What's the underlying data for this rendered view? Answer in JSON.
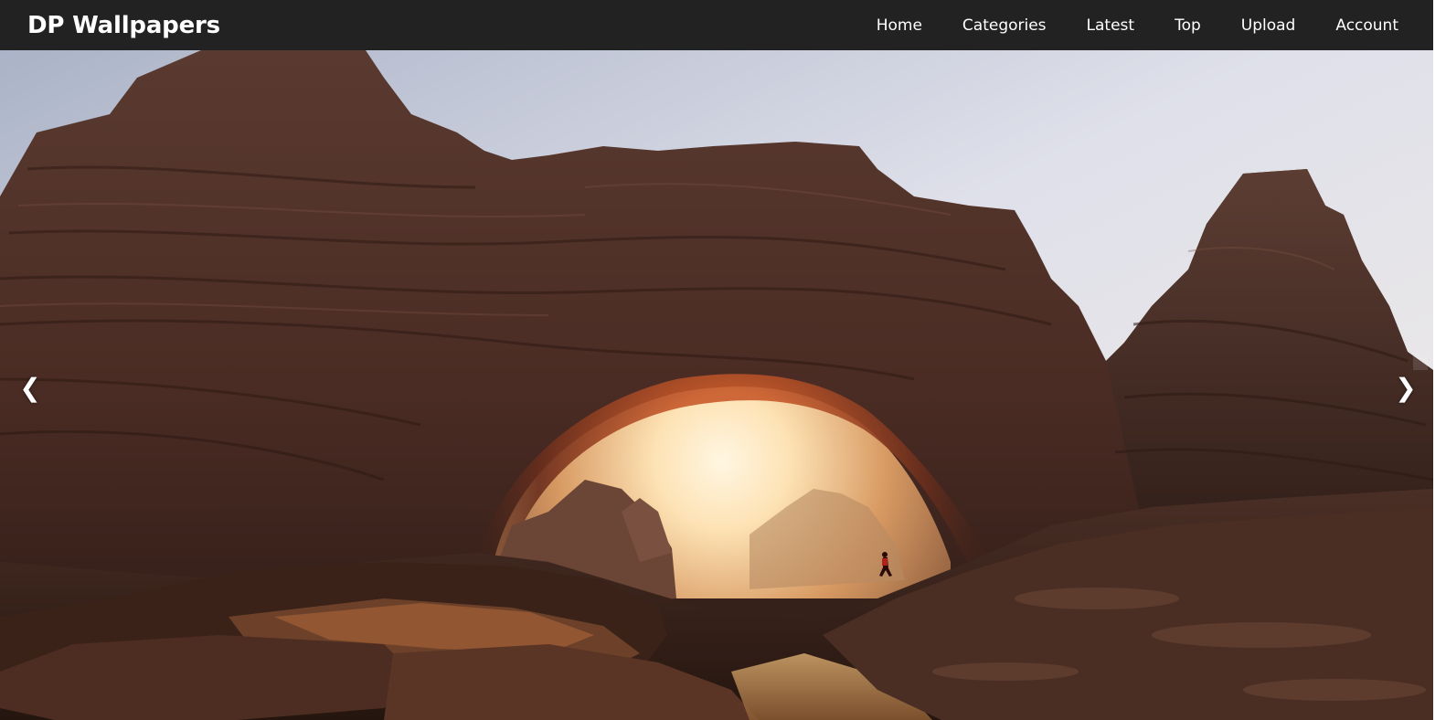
{
  "navbar": {
    "brand": "DP Wallpapers",
    "links": [
      {
        "label": "Home"
      },
      {
        "label": "Categories"
      },
      {
        "label": "Latest"
      },
      {
        "label": "Top"
      },
      {
        "label": "Upload"
      },
      {
        "label": "Account"
      }
    ]
  },
  "carousel": {
    "prev_glyph": "❮",
    "next_glyph": "❯",
    "prev_icon": "chevron-left-icon",
    "next_icon": "chevron-right-icon"
  },
  "colors": {
    "navbar_bg": "#222222",
    "nav_text": "#ffffff"
  }
}
